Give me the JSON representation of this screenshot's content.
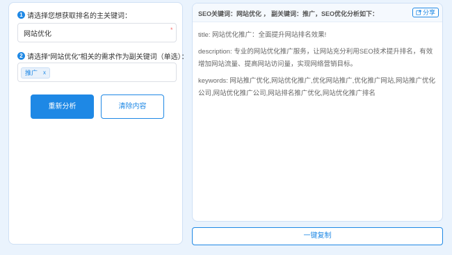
{
  "form": {
    "step1": {
      "number": "1",
      "label": "请选择您想获取排名的主关键词："
    },
    "main_keyword_value": "网站优化",
    "required_mark": "*",
    "step2": {
      "number": "2",
      "label": "请选择“网站优化”相关的需求作为副关键词（单选）："
    },
    "tags": [
      {
        "label": "推广",
        "close": "x"
      }
    ],
    "reanalyze_label": "重新分析",
    "clear_label": "清除内容"
  },
  "result": {
    "header": "SEO关键词：网站优化 ， 副关键词：推广，SEO优化分析如下：",
    "share_label": "分享",
    "title_line": "title:   网站优化推广：全面提升网站排名效果!",
    "description_line": "description:   专业的网站优化推广服务，让网站充分利用SEO技术提升排名，有效增加网站流量、提高网站访问量，实现网络营销目标。",
    "keywords_line": "keywords:  网站推广优化,网站优化推广,优化网站推广,优化推广网站,网站推广优化公司,网站优化推广公司,网站排名推广优化,网站优化推广排名",
    "copy_label": "一键复制"
  },
  "colors": {
    "accent": "#1e88e5",
    "background": "#eaf3fd",
    "required": "#f56c6c"
  },
  "icons": {
    "share": "share-icon"
  }
}
